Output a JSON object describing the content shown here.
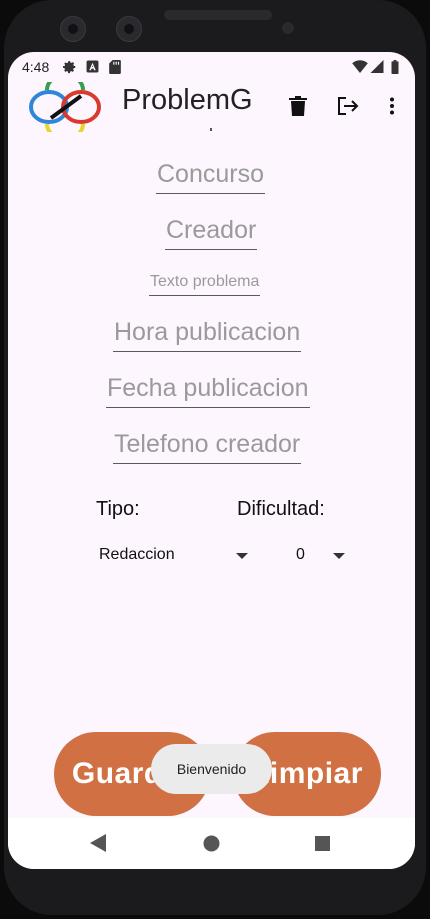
{
  "status": {
    "time": "4:48"
  },
  "app": {
    "title": "ProblemG"
  },
  "fields": {
    "concurso": "Concurso",
    "creador": "Creador",
    "texto_problema": "Texto problema",
    "hora_publicacion": "Hora publicacion",
    "fecha_publicacion": "Fecha publicacion",
    "telefono_creador": "Telefono creador"
  },
  "labels": {
    "tipo": "Tipo:",
    "dificultad": "Dificultad:"
  },
  "spinners": {
    "tipo_value": "Redaccion",
    "dificultad_value": "0"
  },
  "buttons": {
    "guardar": "Guardar",
    "limpiar": "Limpiar"
  },
  "toast": "Bienvenido",
  "colors": {
    "accent": "#d07043",
    "background": "#fdf6fe"
  },
  "icons": [
    "settings-icon",
    "a-icon",
    "sd-card-icon",
    "wifi-icon",
    "signal-icon",
    "battery-icon",
    "trash-icon",
    "logout-icon",
    "more-vert-icon",
    "back-icon",
    "home-icon",
    "recents-icon"
  ]
}
